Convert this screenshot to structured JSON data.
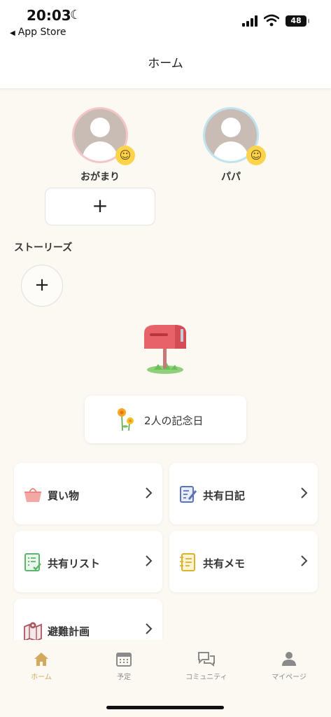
{
  "status_bar": {
    "time": "20:03",
    "back_app": "App Store",
    "battery": "48"
  },
  "nav": {
    "title": "ホーム"
  },
  "profiles": [
    {
      "name": "おがまり",
      "ring_color": "#f5c6c8",
      "mood_icon": "smile-face"
    },
    {
      "name": "パパ",
      "ring_color": "#bfe3ef",
      "mood_icon": "smile-face"
    }
  ],
  "add_profile": {
    "label": "+"
  },
  "stories": {
    "label": "ストーリーズ",
    "add_label": "+"
  },
  "anniversary": {
    "label": "2人の記念日"
  },
  "menu": [
    {
      "label": "買い物",
      "icon": "basket-icon",
      "color": "#e78a86"
    },
    {
      "label": "共有日記",
      "icon": "diary-icon",
      "color": "#5b74b8"
    },
    {
      "label": "共有リスト",
      "icon": "checklist-icon",
      "color": "#5cb36a"
    },
    {
      "label": "共有メモ",
      "icon": "memo-icon",
      "color": "#d9b32a"
    },
    {
      "label": "避難計画",
      "icon": "map-pin-icon",
      "color": "#a8585f"
    }
  ],
  "tabs": [
    {
      "label": "ホーム",
      "icon": "home-icon",
      "active": true
    },
    {
      "label": "予定",
      "icon": "calendar-icon",
      "active": false
    },
    {
      "label": "コミュニティ",
      "icon": "chat-icon",
      "active": false
    },
    {
      "label": "マイページ",
      "icon": "person-icon",
      "active": false
    }
  ],
  "colors": {
    "background": "#fbf9f2",
    "accent": "#d3a95e",
    "mood": "#fbd44b"
  }
}
